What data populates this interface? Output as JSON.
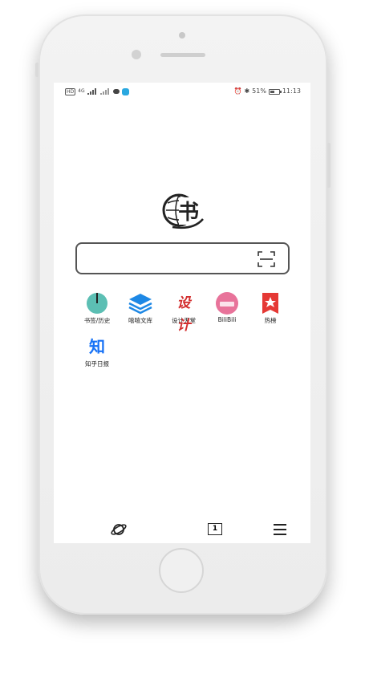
{
  "status_bar": {
    "left_text": "HD",
    "network": "4G",
    "battery_percent": "51%",
    "time": "11:13",
    "icons": [
      "hd-icon",
      "signal-icon",
      "signal-icon",
      "chat-bubble-icon",
      "app-notification-icon",
      "alarm-icon",
      "bluetooth-icon",
      "battery-icon"
    ]
  },
  "logo": {
    "glyph": "书"
  },
  "search": {
    "value": "",
    "placeholder": "",
    "icon": "scan-icon"
  },
  "shortcuts": [
    {
      "label": "书签/历史",
      "icon": "bookmark-history-icon",
      "color": "#5cbfb4"
    },
    {
      "label": "嘻嘻文库",
      "icon": "layers-icon",
      "color": "#1e88e5"
    },
    {
      "label": "设计天堂",
      "icon": "design-text-icon",
      "text": "设计",
      "color": "#d32f2f"
    },
    {
      "label": "BiliBili",
      "icon": "bilibili-icon",
      "color": "#e8739a"
    },
    {
      "label": "热榜",
      "icon": "hot-star-icon",
      "color": "#e53935"
    },
    {
      "label": "知乎日报",
      "icon": "zhihu-icon",
      "text": "知",
      "color": "#1772f6"
    }
  ],
  "bottom_bar": {
    "items": [
      {
        "icon": "planet-icon"
      },
      {
        "icon": "tabs-icon",
        "count": "1"
      },
      {
        "icon": "menu-icon"
      }
    ]
  }
}
